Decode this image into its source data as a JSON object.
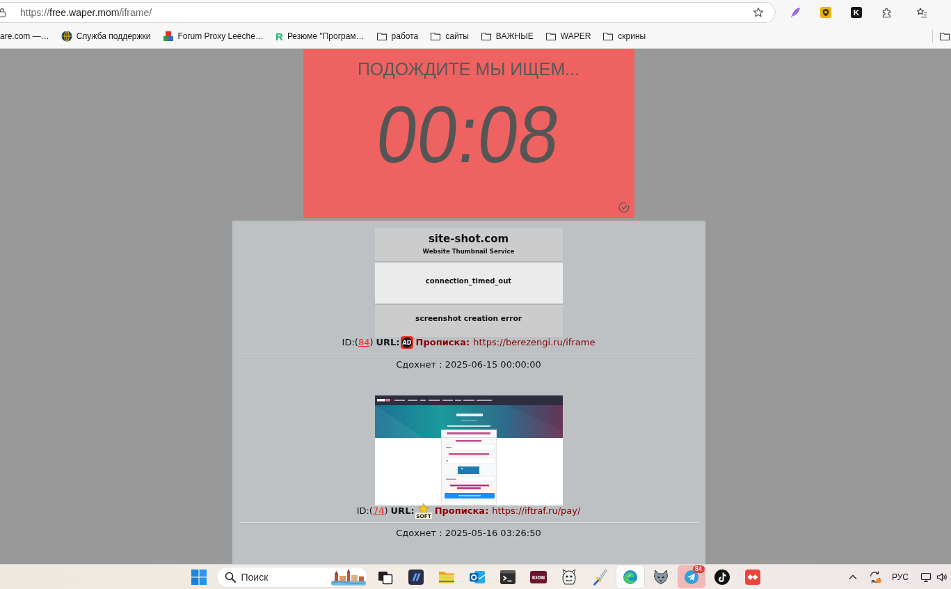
{
  "browser": {
    "address": {
      "scheme": "https://",
      "host": "free.waper.mom",
      "path": "/iframe/"
    },
    "extensions": [
      {
        "kind": "feather"
      },
      {
        "kind": "shield"
      },
      {
        "kind": "letter",
        "icon_text": "K"
      },
      {
        "kind": "puzzle"
      }
    ]
  },
  "bookmarks": [
    {
      "label": "are.com —…",
      "kind": "none"
    },
    {
      "label": "Служба поддержки",
      "kind": "globe"
    },
    {
      "label": "Forum Proxy Leeche…",
      "kind": "cubes"
    },
    {
      "label": "Резюме \"Програм…",
      "kind": "letter",
      "icon_text": "R"
    },
    {
      "label": "работа",
      "kind": "folder"
    },
    {
      "label": "сайты",
      "kind": "folder"
    },
    {
      "label": "ВАЖНЫЕ",
      "kind": "folder"
    },
    {
      "label": "WAPER",
      "kind": "folder"
    },
    {
      "label": "скрины",
      "kind": "folder"
    }
  ],
  "timer": {
    "title": "ПОДОЖДИТЕ МЫ ИЩЕМ...",
    "time": "00:08"
  },
  "entries": [
    {
      "thumbnail": {
        "kind": "error_card",
        "brand": "site-shot.com",
        "tagline": "Website Thumbnail Service",
        "message": "connection_timed_out",
        "error": "screenshot creation error"
      },
      "id_prefix": "ID:(",
      "id": "84",
      "id_suffix": ")",
      "url_label": "URL:",
      "site_icon": {
        "kind": "ad",
        "icon_text": "AD"
      },
      "registration_label": "Прописка:",
      "url": "https://berezengi.ru/iframe",
      "expires": "Сдохнет : 2025-06-15 00:00:00"
    },
    {
      "thumbnail": {
        "kind": "webpage"
      },
      "id_prefix": "ID:(",
      "id": "74",
      "id_suffix": ")",
      "url_label": "URL:",
      "site_icon": {
        "kind": "star",
        "icon_text": "SOFT"
      },
      "registration_label": "Прописка:",
      "url": "https://iftraf.ru/pay/",
      "expires": "Сдохнет : 2025-05-16 03:26:50"
    }
  ],
  "taskbar": {
    "search": {
      "placeholder": "Поиск"
    },
    "apps": [
      {
        "kind": "task_view",
        "selected": false,
        "attention": false
      },
      {
        "kind": "slashes",
        "selected": false,
        "attention": false
      },
      {
        "kind": "folder",
        "selected": false,
        "attention": false
      },
      {
        "kind": "mail",
        "selected": false,
        "attention": false
      },
      {
        "kind": "terminal",
        "selected": false,
        "attention": false
      },
      {
        "kind": "tv_logo",
        "icon_text": "KION",
        "selected": false,
        "attention": false
      },
      {
        "kind": "mascot",
        "selected": false,
        "attention": false
      },
      {
        "kind": "sword",
        "selected": false,
        "attention": false
      },
      {
        "kind": "swirl",
        "selected": true,
        "attention": false
      },
      {
        "kind": "wolf",
        "selected": false,
        "attention": false
      },
      {
        "kind": "paper_plane",
        "badge": "84",
        "selected": false,
        "attention": true
      },
      {
        "kind": "music_note",
        "selected": false,
        "attention": false
      },
      {
        "kind": "diamond",
        "selected": false,
        "attention": false
      }
    ],
    "language": "РУС"
  }
}
